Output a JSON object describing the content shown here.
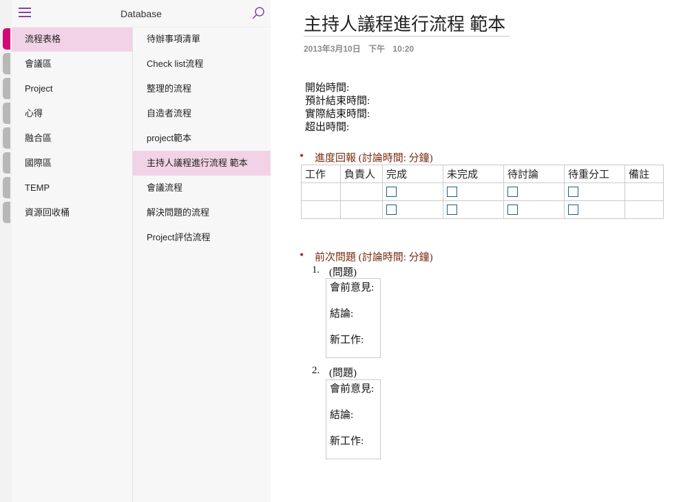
{
  "notebook": {
    "title": "Database"
  },
  "sections": [
    {
      "label": "流程表格",
      "active": true
    },
    {
      "label": "會議區"
    },
    {
      "label": "Project"
    },
    {
      "label": "心得"
    },
    {
      "label": "融合區"
    },
    {
      "label": "國際區"
    },
    {
      "label": "TEMP"
    },
    {
      "label": "資源回收桶"
    }
  ],
  "pages": [
    {
      "label": "待辦事項清單"
    },
    {
      "label": "Check list流程"
    },
    {
      "label": "整理的流程"
    },
    {
      "label": "自造者流程"
    },
    {
      "label": "project範本"
    },
    {
      "label": "主持人議程進行流程 範本",
      "active": true
    },
    {
      "label": "會議流程"
    },
    {
      "label": "解決問題的流程"
    },
    {
      "label": "Project評估流程"
    }
  ],
  "page": {
    "title": "主持人議程進行流程 範本",
    "date": "2013年3月10日",
    "time": "下午 10:20",
    "time_fields": [
      "開始時間:",
      "預計結束時間:",
      "實際結束時間:",
      "超出時間:"
    ],
    "progress_heading": "進度回報 (討論時間: 分鐘)",
    "progress_table": {
      "headers": [
        "工作",
        "負責人",
        "完成",
        "未完成",
        "待討論",
        "待重分工",
        "備註"
      ]
    },
    "previous_heading": "前次問題 (討論時間: 分鐘)",
    "issues": [
      {
        "number": "1.",
        "label": "(問題)",
        "fields": [
          "會前意見:",
          "結論:",
          "新工作:"
        ]
      },
      {
        "number": "2.",
        "label": "(問題)",
        "fields": [
          "會前意見:",
          "結論:",
          "新工作:"
        ]
      }
    ]
  },
  "colors": {
    "accent": "#d10a78",
    "selected": "#f2d2e6",
    "heading": "#7a2a10",
    "icon": "#8b3fa6"
  }
}
